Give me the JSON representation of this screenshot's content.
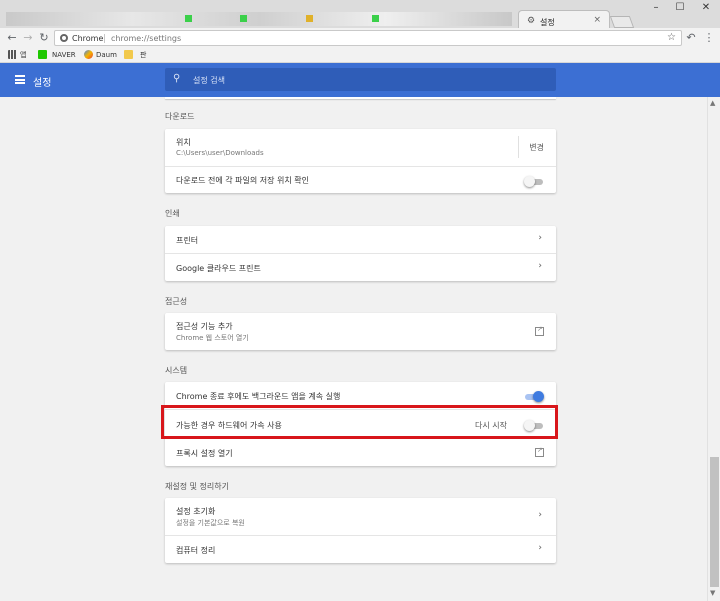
{
  "browser": {
    "active_tab": {
      "title": "설정",
      "close": "×"
    },
    "window_controls": {
      "minimize": "–",
      "maximize": "☐",
      "close": "✕"
    },
    "nav": {
      "back": "←",
      "forward": "→",
      "reload": "↻"
    },
    "omnibox": {
      "scheme_label": "Chrome",
      "url": "chrome://settings",
      "star": "☆"
    },
    "right_icons": {
      "extension": "↶",
      "menu": "⋮"
    },
    "bookmarks": [
      {
        "label": "앱",
        "icon_color": "#4a4a4a"
      },
      {
        "label": "",
        "icon_color": "#1ec800"
      },
      {
        "label": "NAVER",
        "icon_color": "#1ec800"
      },
      {
        "label": "Daum",
        "icon_color": "#f4b400"
      },
      {
        "label": "",
        "icon_color": "#f2c94c"
      },
      {
        "label": "판",
        "icon_color": "#9c9c9c"
      }
    ]
  },
  "header": {
    "title": "설정",
    "search_placeholder": "설정 검색",
    "search_icon": "⚲",
    "accent_color": "#3c6fd3"
  },
  "sections": {
    "downloads": {
      "title": "다운로드",
      "location_label": "위치",
      "location_path": "C:\\Users\\user\\Downloads",
      "change_button": "변경",
      "ask_location_label": "다운로드 전에 각 파일의 저장 위치 확인",
      "ask_location_on": false
    },
    "printing": {
      "title": "인쇄",
      "printers_label": "프린터",
      "cloud_print_label": "Google 클라우드 프린트",
      "chevron": "›"
    },
    "accessibility": {
      "title": "접근성",
      "add_features_label": "접근성 기능 추가",
      "add_features_sub": "Chrome 웹 스토어 열기"
    },
    "system": {
      "title": "시스템",
      "background_apps_label": "Chrome 종료 후에도 백그라운드 앱을 계속 실행",
      "background_apps_on": true,
      "hardware_accel_label": "가능한 경우 하드웨어 가속 사용",
      "relaunch_label": "다시 시작",
      "hardware_accel_on": false,
      "proxy_label": "프록시 설정 열기"
    },
    "reset": {
      "title": "재설정 및 정리하기",
      "reset_label": "설정 초기화",
      "reset_sub": "설정을 기본값으로 복원",
      "cleanup_label": "컴퓨터 정리"
    }
  },
  "highlight_color": "#d8161b"
}
